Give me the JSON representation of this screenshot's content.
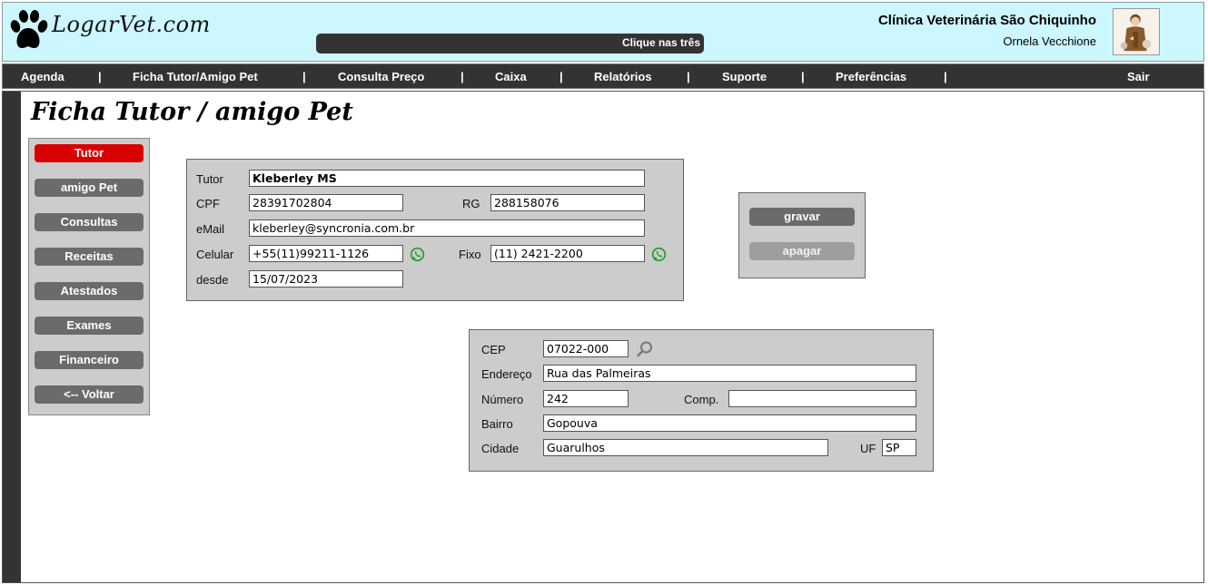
{
  "header": {
    "logo_text": "LogarVet.com",
    "ticker_text": "Clique nas três",
    "clinic_name": "Clínica Veterinária São Chiquinho",
    "user_name": "Ornela Vecchione"
  },
  "menu": {
    "items": [
      "Agenda",
      "Ficha Tutor/Amigo Pet",
      "Consulta Preço",
      "Caixa",
      "Relatórios",
      "Suporte",
      "Preferências"
    ],
    "separator": "|",
    "logout": "Sair"
  },
  "page_title": "Ficha Tutor / amigo Pet",
  "sidenav": {
    "active": "Tutor",
    "items": [
      "Tutor",
      "amigo Pet",
      "Consultas",
      "Receitas",
      "Atestados",
      "Exames",
      "Financeiro",
      "<-- Voltar"
    ]
  },
  "tutor_form": {
    "tutor_label": "Tutor",
    "tutor_value": "Kleberley MS",
    "cpf_label": "CPF",
    "cpf_value": "28391702804",
    "rg_label": "RG",
    "rg_value": "288158076",
    "email_label": "eMail",
    "email_value": "kleberley@syncronia.com.br",
    "celular_label": "Celular",
    "celular_value": "+55(11)99211-1126",
    "fixo_label": "Fixo",
    "fixo_value": "(11) 2421-2200",
    "desde_label": "desde",
    "desde_value": "15/07/2023"
  },
  "actions": {
    "save": "gravar",
    "delete": "apagar"
  },
  "address_form": {
    "cep_label": "CEP",
    "cep_value": "07022-000",
    "endereco_label": "Endereço",
    "endereco_value": "Rua das Palmeiras",
    "numero_label": "Número",
    "numero_value": "242",
    "comp_label": "Comp.",
    "comp_value": "",
    "bairro_label": "Bairro",
    "bairro_value": "Gopouva",
    "cidade_label": "Cidade",
    "cidade_value": "Guarulhos",
    "uf_label": "UF",
    "uf_value": "SP"
  },
  "icons": {
    "logo": "paw-print-icon",
    "avatar": "saint-francis-avatar",
    "phone": "whatsapp-icon",
    "cep_search": "search-icon"
  },
  "colors": {
    "header_bg": "#ccf7ff",
    "menu_bg": "#333333",
    "active_nav": "#d80000",
    "nav_button": "#6b6b6b",
    "panel_bg": "#cccccc",
    "whatsapp": "#1a9e2f"
  }
}
